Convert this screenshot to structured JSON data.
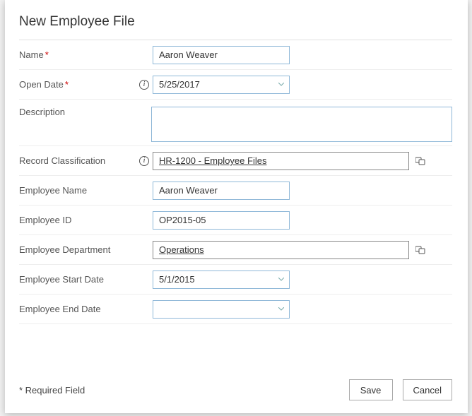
{
  "title": "New Employee File",
  "fields": {
    "name": {
      "label": "Name",
      "required": true,
      "value": "Aaron Weaver"
    },
    "openDate": {
      "label": "Open Date",
      "required": true,
      "value": "5/25/2017"
    },
    "description": {
      "label": "Description",
      "value": ""
    },
    "classification": {
      "label": "Record Classification",
      "value": "HR-1200 - Employee Files"
    },
    "empName": {
      "label": "Employee Name",
      "value": "Aaron Weaver"
    },
    "empId": {
      "label": "Employee ID",
      "value": "OP2015-05"
    },
    "empDept": {
      "label": "Employee Department",
      "value": "Operations"
    },
    "empStart": {
      "label": "Employee Start Date",
      "value": "5/1/2015"
    },
    "empEnd": {
      "label": "Employee End Date",
      "value": ""
    }
  },
  "footer": {
    "requiredNote": "* Required Field",
    "save": "Save",
    "cancel": "Cancel"
  }
}
